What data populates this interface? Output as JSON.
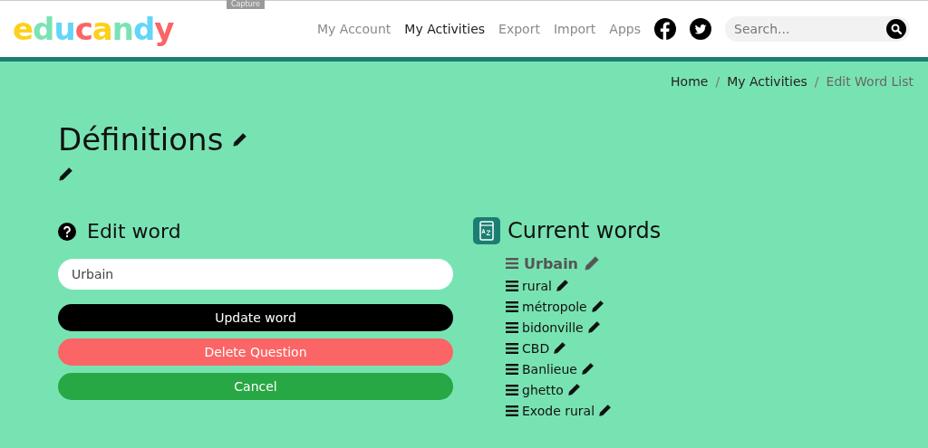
{
  "capture_label": "Capture",
  "logo": {
    "letters": [
      {
        "char": "e",
        "color": "#fdd01c"
      },
      {
        "char": "d",
        "color": "#7be3b2"
      },
      {
        "char": "u",
        "color": "#62d6f7"
      },
      {
        "char": "c",
        "color": "#fb6565"
      },
      {
        "char": "a",
        "color": "#fdd01c"
      },
      {
        "char": "n",
        "color": "#7be3b2"
      },
      {
        "char": "d",
        "color": "#62d6f7"
      },
      {
        "char": "y",
        "color": "#fb6565"
      }
    ]
  },
  "nav": [
    {
      "label": "My Account",
      "selected": false
    },
    {
      "label": "My Activities",
      "selected": true
    },
    {
      "label": "Export",
      "selected": false
    },
    {
      "label": "Import",
      "selected": false
    },
    {
      "label": "Apps",
      "selected": false
    }
  ],
  "search": {
    "placeholder": "Search..."
  },
  "breadcrumb": [
    {
      "label": "Home",
      "current": false
    },
    {
      "label": "My Activities",
      "current": false
    },
    {
      "label": "Edit Word List",
      "current": true
    }
  ],
  "breadcrumb_separators": [
    "/",
    "/"
  ],
  "title": "Définitions",
  "edit_word": {
    "heading": "Edit word",
    "value": "Urbain",
    "buttons": [
      {
        "label": "Update word",
        "kind": "primary"
      },
      {
        "label": "Delete Question",
        "kind": "danger"
      },
      {
        "label": "Cancel",
        "kind": "success"
      }
    ]
  },
  "current_words": {
    "heading": "Current words",
    "words": [
      {
        "label": "Urbain",
        "selected": true
      },
      {
        "label": "rural",
        "selected": false
      },
      {
        "label": "métropole",
        "selected": false
      },
      {
        "label": "bidonville",
        "selected": false
      },
      {
        "label": "CBD",
        "selected": false
      },
      {
        "label": "Banlieue",
        "selected": false
      },
      {
        "label": "ghetto",
        "selected": false
      },
      {
        "label": "Exode rural",
        "selected": false
      }
    ]
  }
}
